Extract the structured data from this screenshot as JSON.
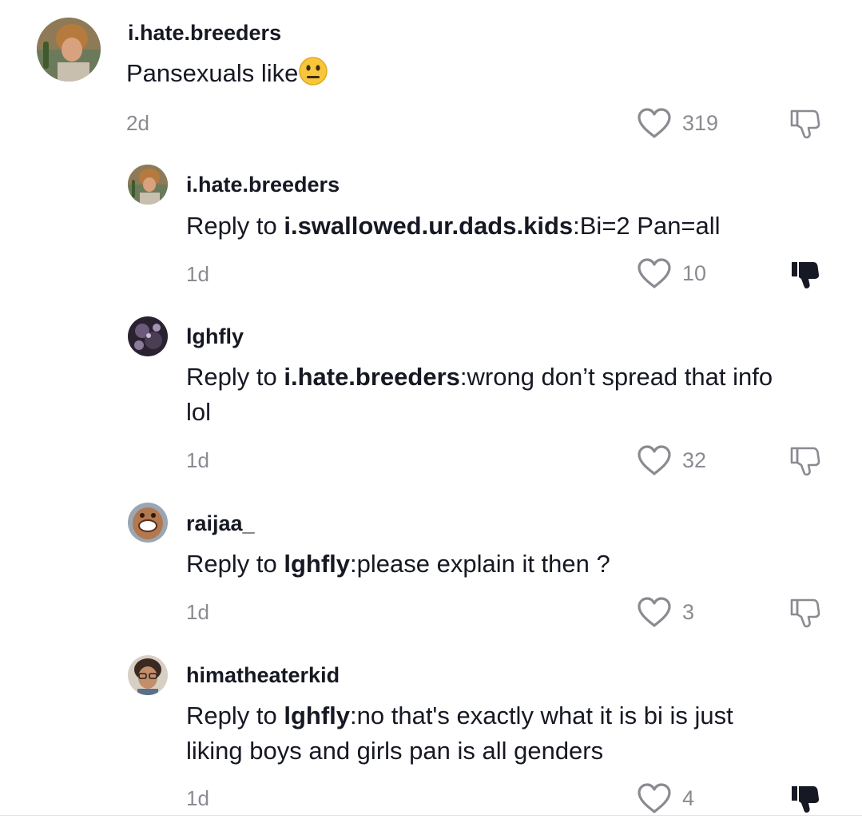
{
  "comments": [
    {
      "username": "i.hate.breeders",
      "reply_prefix": "",
      "reply_target": "",
      "text": "Pansexuals like",
      "emoji": "neutral-face",
      "time": "2d",
      "likes": "319",
      "disliked": false
    },
    {
      "username": "i.hate.breeders",
      "reply_prefix": "Reply to ",
      "reply_target": "i.swallowed.ur.dads.kids",
      "text": ":Bi=2 Pan=all",
      "time": "1d",
      "likes": "10",
      "disliked": true
    },
    {
      "username": "lghfly",
      "reply_prefix": "Reply to ",
      "reply_target": "i.hate.breeders",
      "text": ":wrong don’t spread that info lol",
      "time": "1d",
      "likes": "32",
      "disliked": false
    },
    {
      "username": "raijaa_",
      "reply_prefix": "Reply to ",
      "reply_target": "lghfly",
      "text": ":please explain it then ?",
      "time": "1d",
      "likes": "3",
      "disliked": false
    },
    {
      "username": "himatheaterkid",
      "reply_prefix": "Reply to ",
      "reply_target": "lghfly",
      "text": ":no that's exactly what it is bi is just liking boys and girls pan is all genders",
      "time": "1d",
      "likes": "4",
      "disliked": true
    }
  ],
  "icons": {
    "like": "heart-outline-icon",
    "dislike": "thumbs-down-icon",
    "emoji": "neutral-face-emoji-icon"
  },
  "colors": {
    "text": "#161823",
    "muted": "#8a8b91",
    "dislike_active": "#161823"
  }
}
